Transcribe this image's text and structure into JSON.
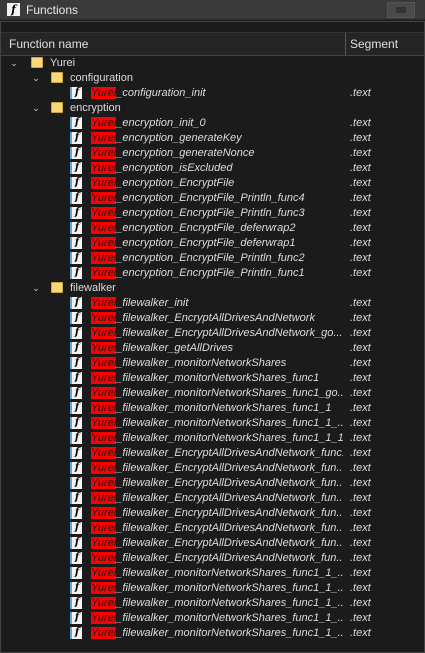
{
  "window": {
    "title": "Functions",
    "title_icon": "function-icon"
  },
  "columns": {
    "name": "Function name",
    "segment": "Segment"
  },
  "tree": {
    "root": {
      "label": "Yurei",
      "expanded": true
    },
    "prefix": "Yurei",
    "groups": [
      {
        "label": "configuration",
        "functions": [
          {
            "rest": "_configuration_init",
            "segment": ".text"
          }
        ]
      },
      {
        "label": "encryption",
        "functions": [
          {
            "rest": "_encryption_init_0",
            "segment": ".text"
          },
          {
            "rest": "_encryption_generateKey",
            "segment": ".text"
          },
          {
            "rest": "_encryption_generateNonce",
            "segment": ".text"
          },
          {
            "rest": "_encryption_isExcluded",
            "segment": ".text"
          },
          {
            "rest": "_encryption_EncryptFile",
            "segment": ".text"
          },
          {
            "rest": "_encryption_EncryptFile_Println_func4",
            "segment": ".text"
          },
          {
            "rest": "_encryption_EncryptFile_Println_func3",
            "segment": ".text"
          },
          {
            "rest": "_encryption_EncryptFile_deferwrap2",
            "segment": ".text"
          },
          {
            "rest": "_encryption_EncryptFile_deferwrap1",
            "segment": ".text"
          },
          {
            "rest": "_encryption_EncryptFile_Println_func2",
            "segment": ".text"
          },
          {
            "rest": "_encryption_EncryptFile_Println_func1",
            "segment": ".text"
          }
        ]
      },
      {
        "label": "filewalker",
        "functions": [
          {
            "rest": "_filewalker_init",
            "segment": ".text"
          },
          {
            "rest": "_filewalker_EncryptAllDrivesAndNetwork",
            "segment": ".text"
          },
          {
            "rest": "_filewalker_EncryptAllDrivesAndNetwork_go...",
            "segment": ".text"
          },
          {
            "rest": "_filewalker_getAllDrives",
            "segment": ".text"
          },
          {
            "rest": "_filewalker_monitorNetworkShares",
            "segment": ".text"
          },
          {
            "rest": "_filewalker_monitorNetworkShares_func1",
            "segment": ".text"
          },
          {
            "rest": "_filewalker_monitorNetworkShares_func1_go...",
            "segment": ".text"
          },
          {
            "rest": "_filewalker_monitorNetworkShares_func1_1",
            "segment": ".text"
          },
          {
            "rest": "_filewalker_monitorNetworkShares_func1_1_...",
            "segment": ".text"
          },
          {
            "rest": "_filewalker_monitorNetworkShares_func1_1_1",
            "segment": ".text"
          },
          {
            "rest": "_filewalker_EncryptAllDrivesAndNetwork_func1",
            "segment": ".text"
          },
          {
            "rest": "_filewalker_EncryptAllDrivesAndNetwork_fun...",
            "segment": ".text"
          },
          {
            "rest": "_filewalker_EncryptAllDrivesAndNetwork_fun...",
            "segment": ".text"
          },
          {
            "rest": "_filewalker_EncryptAllDrivesAndNetwork_fun...",
            "segment": ".text"
          },
          {
            "rest": "_filewalker_EncryptAllDrivesAndNetwork_fun...",
            "segment": ".text"
          },
          {
            "rest": "_filewalker_EncryptAllDrivesAndNetwork_fun...",
            "segment": ".text"
          },
          {
            "rest": "_filewalker_EncryptAllDrivesAndNetwork_fun...",
            "segment": ".text"
          },
          {
            "rest": "_filewalker_EncryptAllDrivesAndNetwork_fun...",
            "segment": ".text"
          },
          {
            "rest": "_filewalker_monitorNetworkShares_func1_1_...",
            "segment": ".text"
          },
          {
            "rest": "_filewalker_monitorNetworkShares_func1_1_...",
            "segment": ".text"
          },
          {
            "rest": "_filewalker_monitorNetworkShares_func1_1_...",
            "segment": ".text"
          },
          {
            "rest": "_filewalker_monitorNetworkShares_func1_1_...",
            "segment": ".text"
          },
          {
            "rest": "_filewalker_monitorNetworkShares_func1_1_...",
            "segment": ".text"
          }
        ]
      }
    ]
  },
  "colors": {
    "highlight": "#ff0000",
    "folder": "#f7d97a",
    "background": "#1b1b1b"
  }
}
